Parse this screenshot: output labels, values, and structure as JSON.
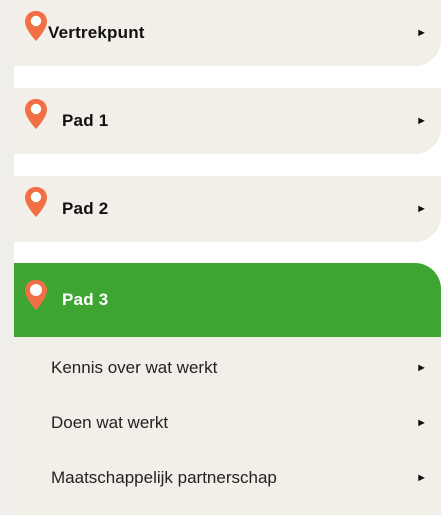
{
  "menu": {
    "items": [
      {
        "label": "Vertrekpunt",
        "arrow": "►",
        "icon": "map-pin-icon",
        "active": false
      },
      {
        "label": "Pad 1",
        "arrow": "►",
        "icon": "map-pin-icon",
        "active": false
      },
      {
        "label": "Pad 2",
        "arrow": "►",
        "icon": "map-pin-icon",
        "active": false
      },
      {
        "label": "Pad 3",
        "arrow": "►",
        "icon": "map-pin-icon",
        "active": true
      }
    ],
    "submenu": [
      {
        "label": "Kennis over wat werkt",
        "arrow": "►"
      },
      {
        "label": "Doen wat werkt",
        "arrow": "►"
      },
      {
        "label": "Maatschappelijk partnerschap",
        "arrow": "►"
      }
    ]
  },
  "colors": {
    "pin": "#f06f45",
    "pin_active_body": "#f06f45",
    "pin_dot": "#ffffff",
    "active_bg": "#3ea533",
    "item_bg": "#f2efe9"
  }
}
